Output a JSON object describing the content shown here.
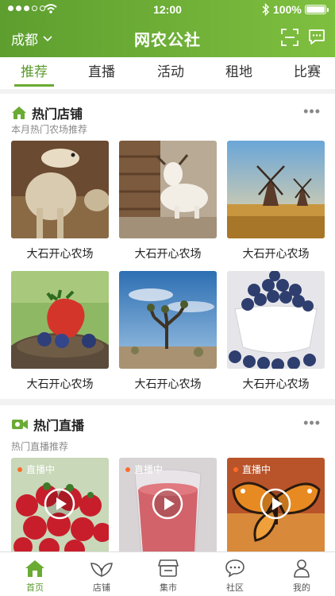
{
  "status_bar": {
    "time": "12:00",
    "battery": "100%"
  },
  "header": {
    "city": "成都",
    "title": "网农公社"
  },
  "tabs": [
    {
      "label": "推荐"
    },
    {
      "label": "直播"
    },
    {
      "label": "活动"
    },
    {
      "label": "租地"
    },
    {
      "label": "比赛"
    }
  ],
  "shops_section": {
    "title": "热门店铺",
    "subtitle": "本月热门农场推荐",
    "items": [
      {
        "name": "大石开心农场"
      },
      {
        "name": "大石开心农场"
      },
      {
        "name": "大石开心农场"
      },
      {
        "name": "大石开心农场"
      },
      {
        "name": "大石开心农场"
      },
      {
        "name": "大石开心农场"
      }
    ]
  },
  "live_section": {
    "title": "热门直播",
    "subtitle": "热门直播推荐",
    "items": [
      {
        "badge": "直播中"
      },
      {
        "badge": "直播中"
      },
      {
        "badge": "直播中"
      }
    ]
  },
  "bottom_nav": [
    {
      "label": "首页"
    },
    {
      "label": "店铺"
    },
    {
      "label": "集市"
    },
    {
      "label": "社区"
    },
    {
      "label": "我的"
    }
  ],
  "colors": {
    "brand": "#6aab34",
    "accent_live": "#ff6a2a"
  }
}
